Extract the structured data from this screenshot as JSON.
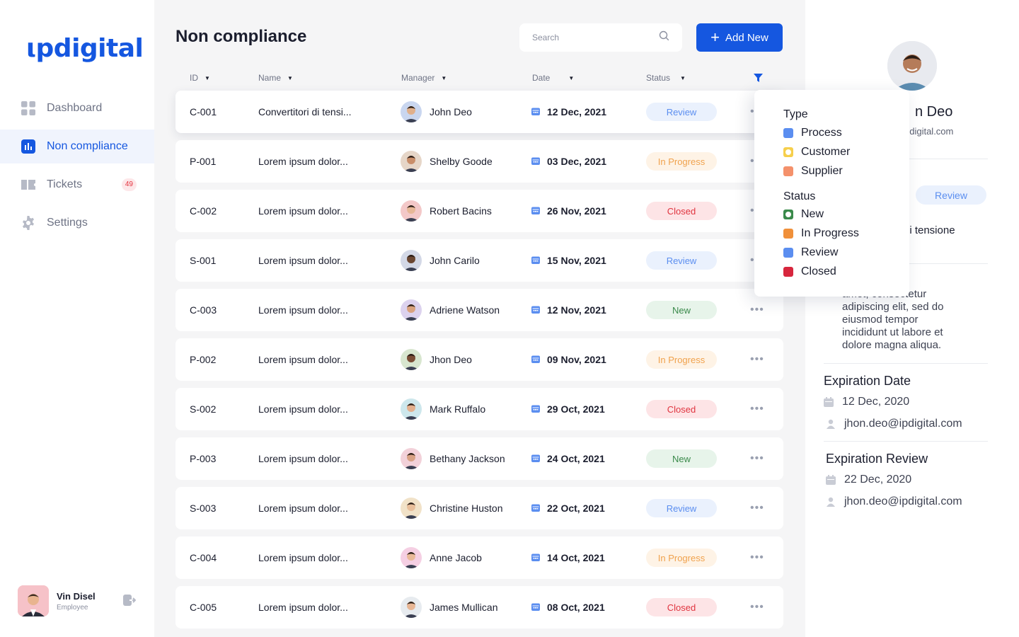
{
  "app": {
    "logo": "ιpdigital"
  },
  "sidebar": {
    "items": [
      {
        "label": "Dashboard",
        "icon": "grid-icon"
      },
      {
        "label": "Non compliance",
        "icon": "bar-chart-icon"
      },
      {
        "label": "Tickets",
        "icon": "tickets-icon",
        "badge": "49"
      },
      {
        "label": "Settings",
        "icon": "gear-icon"
      }
    ],
    "active_index": 1
  },
  "user": {
    "name": "Vin Disel",
    "role": "Employee"
  },
  "header": {
    "title": "Non compliance",
    "search_placeholder": "Search",
    "add_label": "Add New"
  },
  "table": {
    "columns": [
      "ID",
      "Name",
      "Manager",
      "Date",
      "Status"
    ],
    "rows": [
      {
        "id": "C-001",
        "name": "Convertitori di tensi...",
        "manager": "John Deo",
        "date": "12 Dec, 2021",
        "status": "Review"
      },
      {
        "id": "P-001",
        "name": "Lorem ipsum dolor...",
        "manager": "Shelby Goode",
        "date": "03 Dec, 2021",
        "status": "In Progress"
      },
      {
        "id": "C-002",
        "name": "Lorem ipsum dolor...",
        "manager": "Robert Bacins",
        "date": "26 Nov, 2021",
        "status": "Closed"
      },
      {
        "id": "S-001",
        "name": "Lorem ipsum dolor...",
        "manager": "John Carilo",
        "date": "15 Nov, 2021",
        "status": "Review"
      },
      {
        "id": "C-003",
        "name": "Lorem ipsum dolor...",
        "manager": "Adriene Watson",
        "date": "12 Nov, 2021",
        "status": "New"
      },
      {
        "id": "P-002",
        "name": "Lorem ipsum dolor...",
        "manager": "Jhon Deo",
        "date": "09 Nov, 2021",
        "status": "In Progress"
      },
      {
        "id": "S-002",
        "name": "Lorem ipsum dolor...",
        "manager": "Mark Ruffalo",
        "date": "29 Oct, 2021",
        "status": "Closed"
      },
      {
        "id": "P-003",
        "name": "Lorem ipsum dolor...",
        "manager": "Bethany Jackson",
        "date": "24 Oct, 2021",
        "status": "New"
      },
      {
        "id": "S-003",
        "name": "Lorem ipsum dolor...",
        "manager": "Christine Huston",
        "date": "22 Oct, 2021",
        "status": "Review"
      },
      {
        "id": "C-004",
        "name": "Lorem ipsum dolor...",
        "manager": "Anne Jacob",
        "date": "14 Oct, 2021",
        "status": "In Progress"
      },
      {
        "id": "C-005",
        "name": "Lorem ipsum dolor...",
        "manager": "James Mullican",
        "date": "08 Oct, 2021",
        "status": "Closed"
      }
    ]
  },
  "filter": {
    "type_heading": "Type",
    "types": [
      {
        "label": "Process",
        "color": "#5b8ef0",
        "style": "filled"
      },
      {
        "label": "Customer",
        "color": "#f6cf4c",
        "style": "outline"
      },
      {
        "label": "Supplier",
        "color": "#f4916b",
        "style": "filled"
      }
    ],
    "status_heading": "Status",
    "statuses": [
      {
        "label": "New",
        "color": "#3a8a4b",
        "style": "outline"
      },
      {
        "label": "In Progress",
        "color": "#f0903a",
        "style": "filled"
      },
      {
        "label": "Review",
        "color": "#5b8ef0",
        "style": "filled"
      },
      {
        "label": "Closed",
        "color": "#d7263d",
        "style": "filled"
      }
    ]
  },
  "detail": {
    "name": "n Deo",
    "email": "pdigital.com",
    "status": "Review",
    "subname": "li tensione",
    "description": "dolor sit\namet, consectetur adipiscing elit, sed do eiusmod tempor incididunt ut labore et dolore magna aliqua.",
    "expiration_date_title": "Expiration Date",
    "expiration_date": "12 Dec, 2020",
    "expiration_date_email": "jhon.deo@ipdigital.com",
    "expiration_review_title": "Expiration Review",
    "expiration_review": "22 Dec, 2020",
    "expiration_review_email": "jhon.deo@ipdigital.com"
  }
}
